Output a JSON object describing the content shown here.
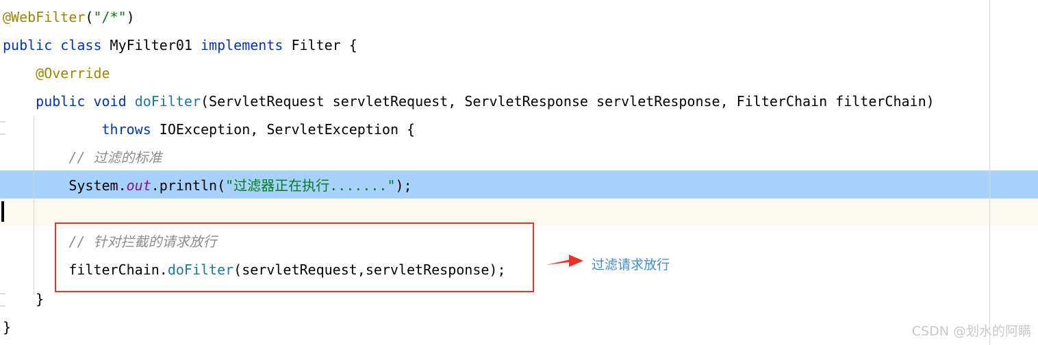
{
  "editor": {
    "background_color": "#ffffff",
    "selection_color": "#a6d2fd",
    "caret_line_color": "#faf8ef",
    "guide_color": "#d9d9d9",
    "code_lines": [
      {
        "id": "line-webfilter",
        "indent": "",
        "tokens": [
          {
            "text": "@WebFilter",
            "style": "annot"
          },
          {
            "text": "(",
            "style": "plain"
          },
          {
            "text": "\"/*\"",
            "style": "string"
          },
          {
            "text": ")",
            "style": "plain"
          }
        ]
      },
      {
        "id": "line-class-decl",
        "indent": "",
        "tokens": [
          {
            "text": "public",
            "style": "keyword"
          },
          {
            "text": " ",
            "style": "plain"
          },
          {
            "text": "class",
            "style": "keyword"
          },
          {
            "text": " MyFilter01 ",
            "style": "plain"
          },
          {
            "text": "implements",
            "style": "keyword"
          },
          {
            "text": " Filter {",
            "style": "plain"
          }
        ]
      },
      {
        "id": "line-override",
        "indent": "    ",
        "tokens": [
          {
            "text": "@Override",
            "style": "annot"
          }
        ]
      },
      {
        "id": "line-dofilter-signature",
        "indent": "    ",
        "tokens": [
          {
            "text": "public",
            "style": "keyword"
          },
          {
            "text": " ",
            "style": "plain"
          },
          {
            "text": "void",
            "style": "keyword"
          },
          {
            "text": " ",
            "style": "plain"
          },
          {
            "text": "doFilter",
            "style": "method"
          },
          {
            "text": "(ServletRequest servletRequest, ServletResponse servletResponse, FilterChain filterChain)",
            "style": "plain"
          }
        ]
      },
      {
        "id": "line-throws",
        "indent": "            ",
        "tokens": [
          {
            "text": "throws",
            "style": "keyword"
          },
          {
            "text": " IOException, ServletException {",
            "style": "plain"
          }
        ]
      },
      {
        "id": "line-comment-standard",
        "indent": "        ",
        "tokens": [
          {
            "text": "// 过滤的标准",
            "style": "comment"
          }
        ]
      },
      {
        "id": "line-println",
        "indent": "        ",
        "tokens": [
          {
            "text": "System.",
            "style": "plain"
          },
          {
            "text": "out",
            "style": "static"
          },
          {
            "text": ".println(",
            "style": "plain"
          },
          {
            "text": "\"过滤器正在执行.......\"",
            "style": "string"
          },
          {
            "text": ");",
            "style": "plain"
          }
        ]
      },
      {
        "id": "line-comment-passthrough",
        "indent": "        ",
        "tokens": [
          {
            "text": "// 针对拦截的请求放行",
            "style": "comment"
          }
        ]
      },
      {
        "id": "line-chain-dofilter",
        "indent": "        ",
        "tokens": [
          {
            "text": "filterChain.",
            "style": "plain"
          },
          {
            "text": "doFilter",
            "style": "method"
          },
          {
            "text": "(servletRequest,servletResponse);",
            "style": "plain"
          }
        ]
      },
      {
        "id": "line-close-method",
        "indent": "    ",
        "tokens": [
          {
            "text": "}",
            "style": "plain"
          }
        ]
      },
      {
        "id": "line-close-class",
        "indent": "",
        "tokens": [
          {
            "text": "}",
            "style": "plain"
          }
        ]
      }
    ]
  },
  "annotation": {
    "label": "过滤请求放行",
    "label_color": "#3d8ae3",
    "box_color": "#e8342a",
    "arrow_color": "#f22d22"
  },
  "watermark": {
    "text": "CSDN @划水的阿瞒",
    "color": "#c8c8c8"
  }
}
